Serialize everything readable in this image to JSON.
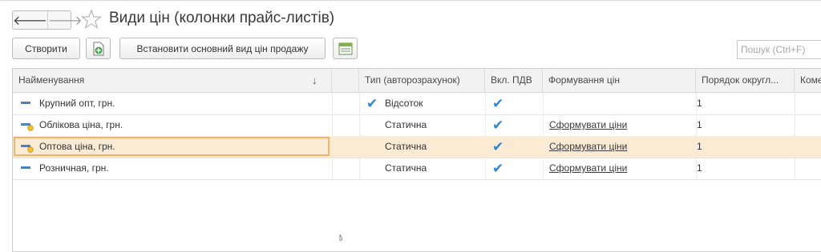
{
  "header": {
    "title": "Види цін (колонки прайс-листів)",
    "back_glyph": "🡐",
    "forward_glyph": "🡒"
  },
  "toolbar": {
    "create_label": "Створити",
    "set_main_label": "Встановити основний вид цін продажу",
    "search_placeholder": "Пошук (Ctrl+F)"
  },
  "table": {
    "columns": [
      "Найменування",
      "Тип (авторозрахунок)",
      "Вкл. ПДВ",
      "Формування цін",
      "Порядок округл...",
      "Коме"
    ],
    "sort_indicator": "↓",
    "rows": [
      {
        "name": "Крупний опт, грн.",
        "icon": "price-type-plain-icon",
        "type": "Відсоток",
        "type_checked": true,
        "vat": "✔",
        "formation": "",
        "rounding": "1"
      },
      {
        "name": "Облікова ціна, грн.",
        "icon": "price-type-marked-icon",
        "type": "Статична",
        "type_checked": false,
        "vat": "✔",
        "formation": "Сформувати ціни",
        "rounding": "1"
      },
      {
        "name": "Оптова ціна, грн.",
        "icon": "price-type-marked-icon",
        "type": "Статична",
        "type_checked": false,
        "vat": "✔",
        "formation": "Сформувати ціни",
        "rounding": "1",
        "selected": true
      },
      {
        "name": "Розничная, грн.",
        "icon": "price-type-plain-icon",
        "type": "Статична",
        "type_checked": false,
        "vat": "✔",
        "formation": "Сформувати ціни",
        "rounding": "1"
      }
    ]
  },
  "colors": {
    "selected_row": "#fbebd5",
    "focus_border": "#f0b46a",
    "check": "#2f86d6",
    "icon_blue": "#4f7fbf",
    "icon_yellow": "#f0c030"
  }
}
